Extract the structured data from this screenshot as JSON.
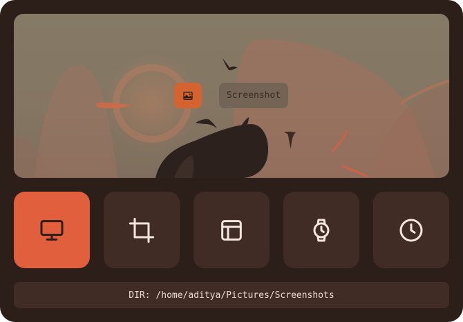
{
  "preview": {
    "label": "Screenshot",
    "badge_icon": "image-icon"
  },
  "modes": [
    {
      "name": "screen",
      "icon": "monitor-icon",
      "active": true
    },
    {
      "name": "crop",
      "icon": "crop-icon",
      "active": false
    },
    {
      "name": "window",
      "icon": "window-layout-icon",
      "active": false
    },
    {
      "name": "timer",
      "icon": "watch-icon",
      "active": false
    },
    {
      "name": "delay",
      "icon": "clock-icon",
      "active": false
    }
  ],
  "footer": {
    "directory": "DIR: /home/aditya/Pictures/Screenshots"
  },
  "colors": {
    "background": "#2c1f1a",
    "tile": "#412c25",
    "accent": "#e25f3e",
    "icon": "#f3e7e0"
  }
}
